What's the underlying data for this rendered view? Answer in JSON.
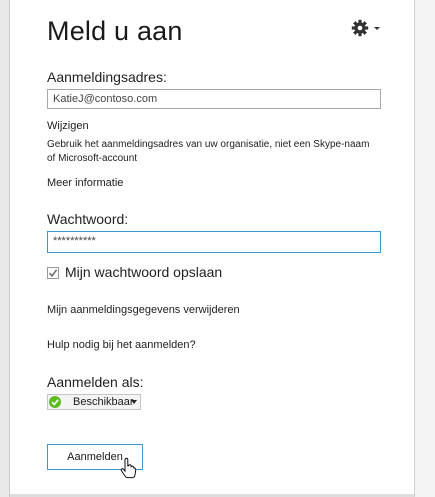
{
  "dialog": {
    "title": "Meld u aan",
    "settings_icon": "gear-icon"
  },
  "signin_address": {
    "label": "Aanmeldingsadres:",
    "value": "KatieJ@contoso.com",
    "change_link": "Wijzigen",
    "hint": "Gebruik het aanmeldingsadres van uw organisatie, niet een Skype-naam",
    "hint_line2": "of Microsoft-account",
    "more_info_link": "Meer informatie"
  },
  "password": {
    "label": "Wachtwoord:",
    "value": "**********",
    "remember_label": "Mijn wachtwoord opslaan",
    "remember_checked": true
  },
  "links": {
    "delete_info": "Mijn aanmeldingsgegevens verwijderen",
    "help": "Hulp nodig bij het aanmelden?"
  },
  "signin_as": {
    "label": "Aanmelden als:",
    "status": "Beschikbaar",
    "status_color": "#5cbb1f"
  },
  "signin_button": {
    "label": "Aanmelden"
  },
  "colors": {
    "accent_border": "#3a96d6"
  }
}
